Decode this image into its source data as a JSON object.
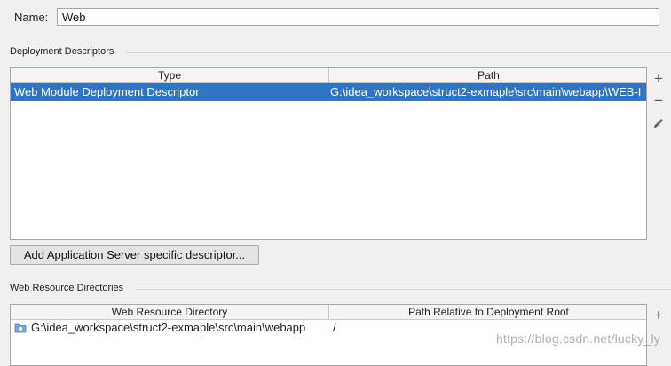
{
  "facet": {
    "name_label": "Name:",
    "name_value": "Web"
  },
  "deployment": {
    "section_title": "Deployment Descriptors",
    "columns": [
      "Type",
      "Path"
    ],
    "rows": [
      {
        "type": "Web Module Deployment Descriptor",
        "path": "G:\\idea_workspace\\struct2-exmaple\\src\\main\\webapp\\WEB-I",
        "selected": true
      }
    ],
    "add_server_button": "Add Application Server specific descriptor..."
  },
  "resources": {
    "section_title": "Web Resource Directories",
    "columns": [
      "Web Resource Directory",
      "Path Relative to Deployment Root"
    ],
    "rows": [
      {
        "directory": "G:\\idea_workspace\\struct2-exmaple\\src\\main\\webapp",
        "relative": "/"
      }
    ]
  },
  "toolbar": {
    "add": "+",
    "remove": "−"
  },
  "watermark": "https://blog.csdn.net/lucky_ly"
}
